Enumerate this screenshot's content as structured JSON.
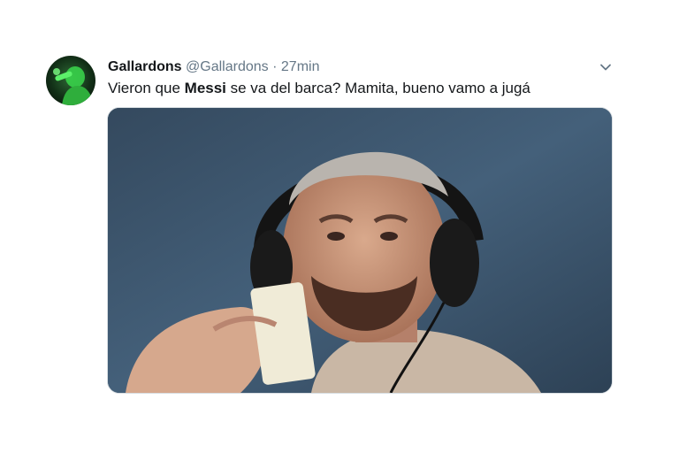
{
  "tweet": {
    "display_name": "Gallardons",
    "handle": "@Gallardons",
    "separator": "·",
    "time": "27min",
    "text_before": "Vieron que ",
    "text_bold": "Messi",
    "text_after": " se va del barca? Mamita, bueno vamo a jugá"
  },
  "icons": {
    "avatar": "avatar-image",
    "menu": "chevron-down-icon"
  },
  "colors": {
    "name": "#14171a",
    "secondary": "#657786",
    "media_background": "#3a4f64"
  }
}
